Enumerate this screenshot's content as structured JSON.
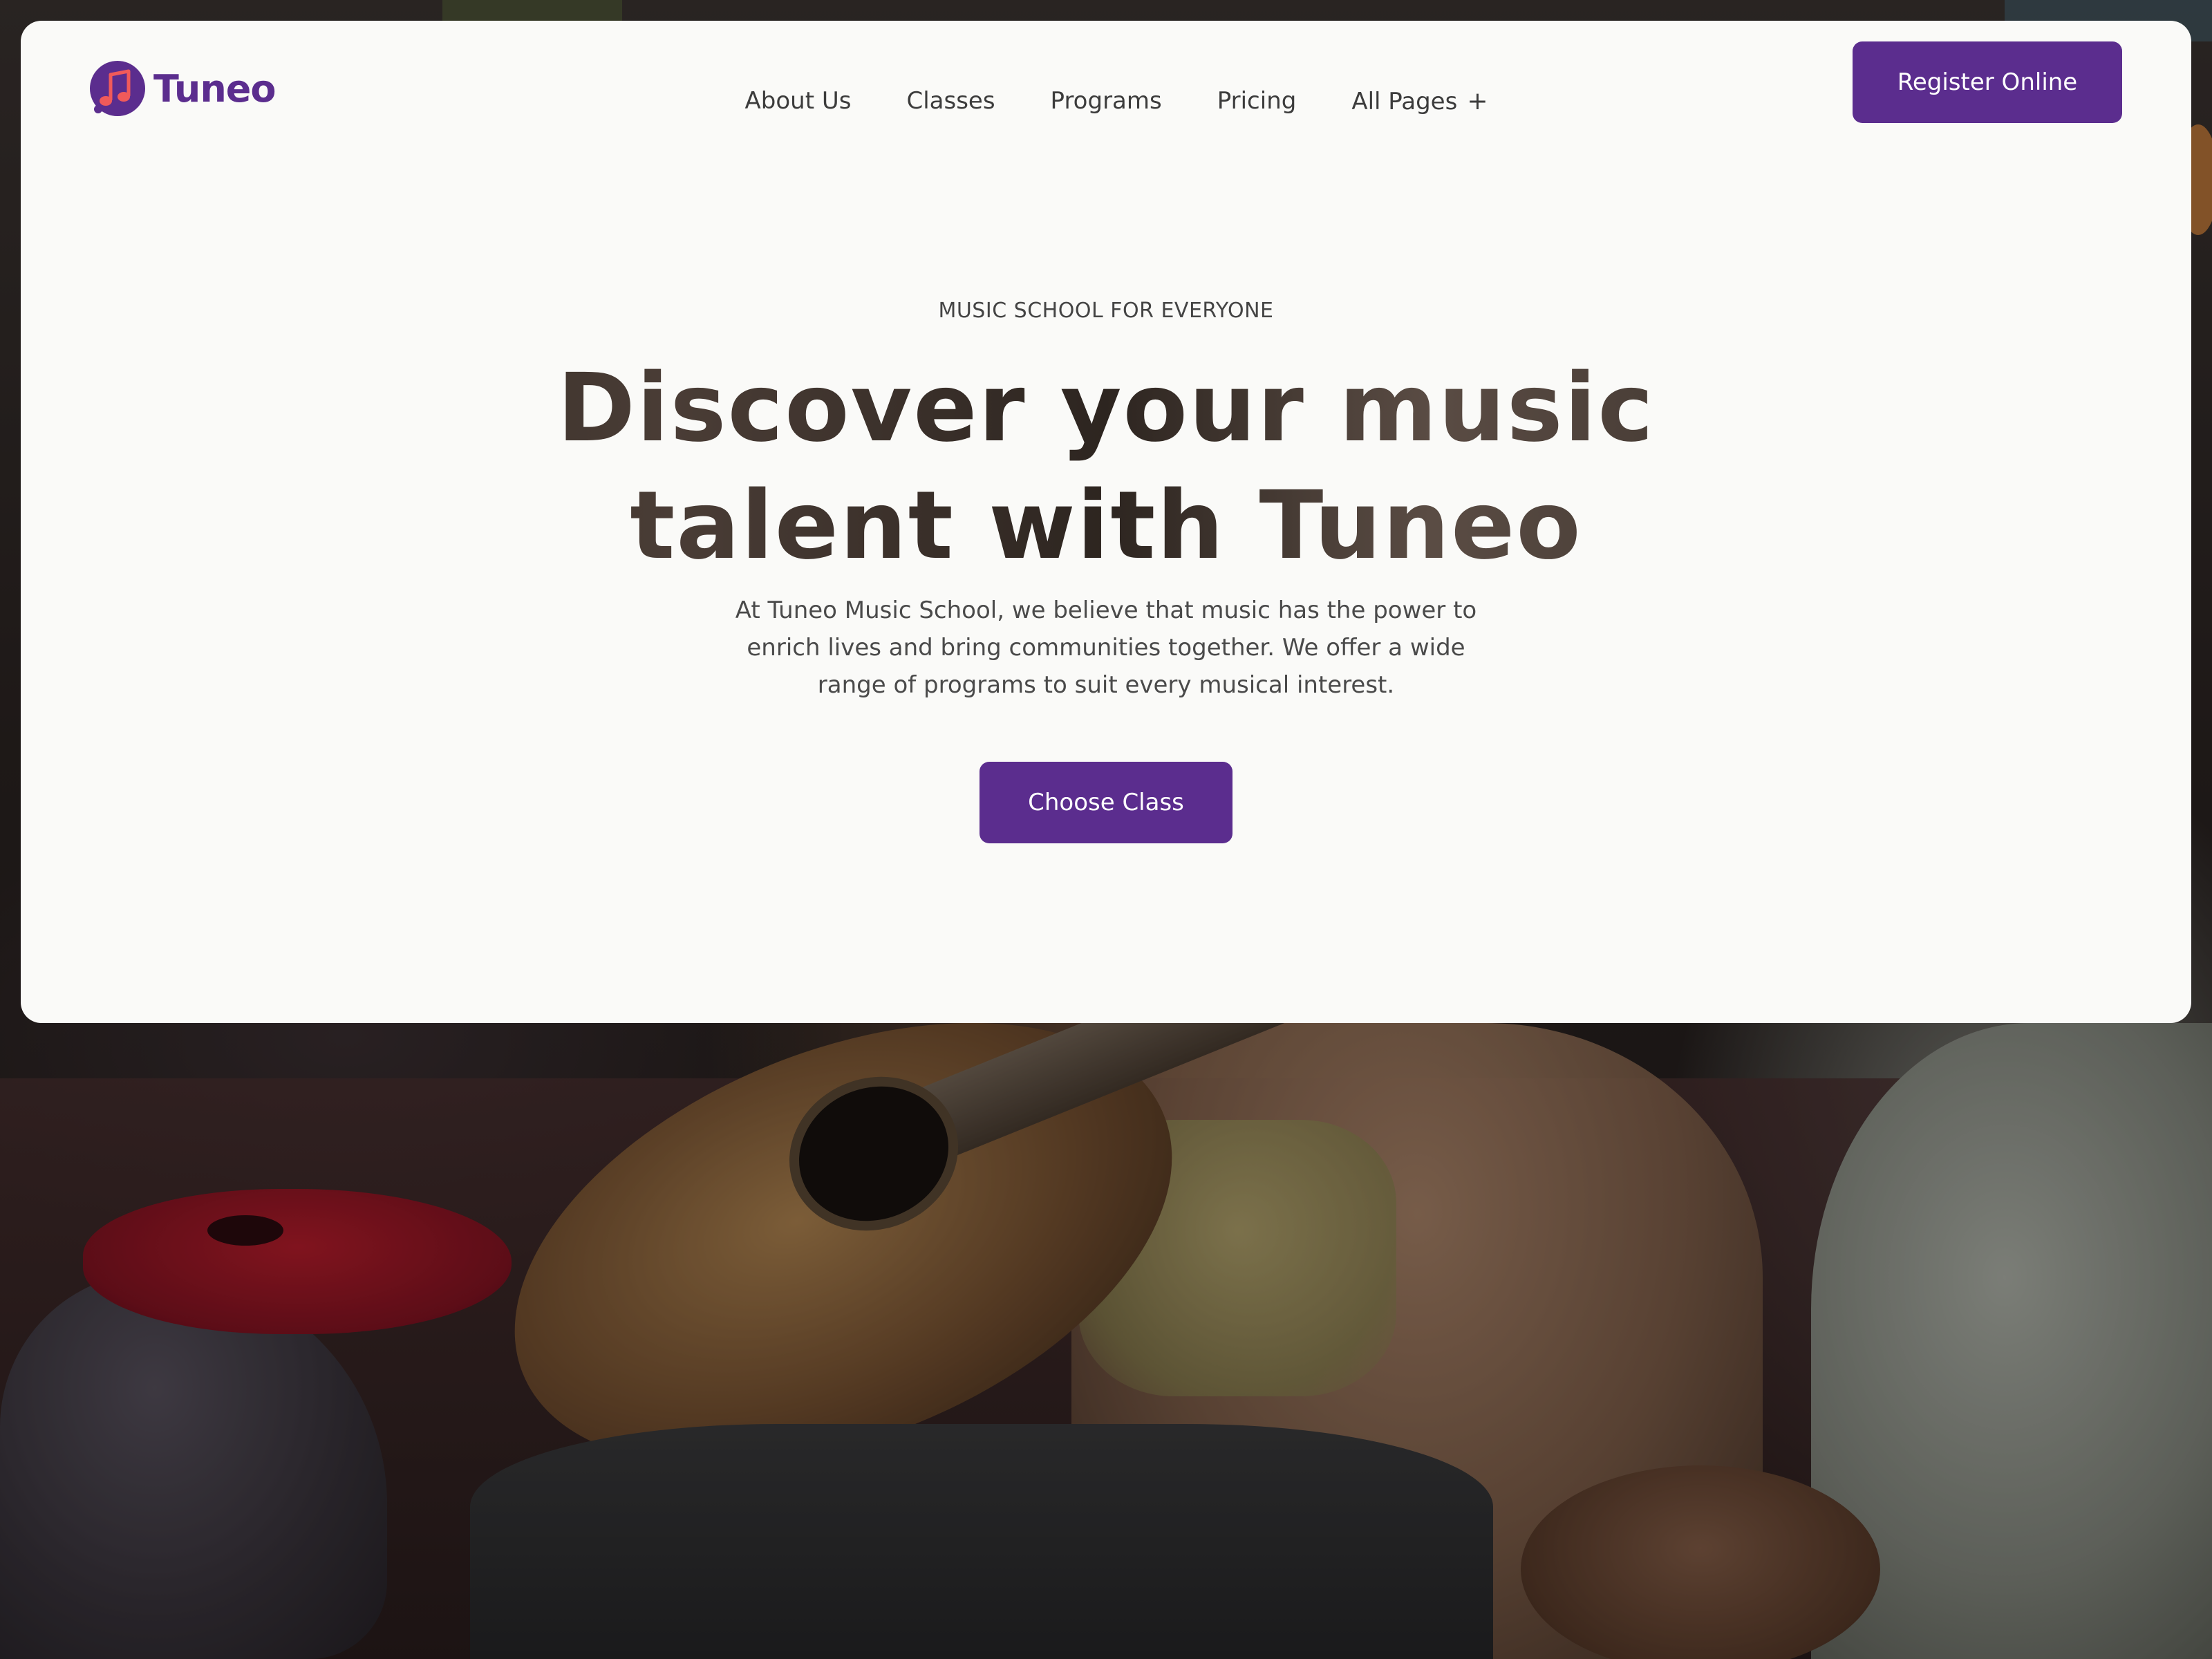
{
  "brand": {
    "name": "Tuneo",
    "primary_color": "#5b2d8e",
    "logo_accent_color": "#f05a5a",
    "logo_icon": "music-note-icon"
  },
  "nav": {
    "items": [
      {
        "label": "About Us"
      },
      {
        "label": "Classes"
      },
      {
        "label": "Programs"
      },
      {
        "label": "Pricing"
      },
      {
        "label": "All Pages",
        "suffix": "+"
      }
    ]
  },
  "header": {
    "cta_label": "Register Online"
  },
  "hero": {
    "eyebrow": "MUSIC SCHOOL FOR EVERYONE",
    "headline_line1": "Discover your music",
    "headline_line2": "talent with Tuneo",
    "description": "At Tuneo Music School, we believe that music has the power to enrich lives and bring communities together. We offer a wide range of programs to suit every musical interest.",
    "cta_label": "Choose Class"
  }
}
